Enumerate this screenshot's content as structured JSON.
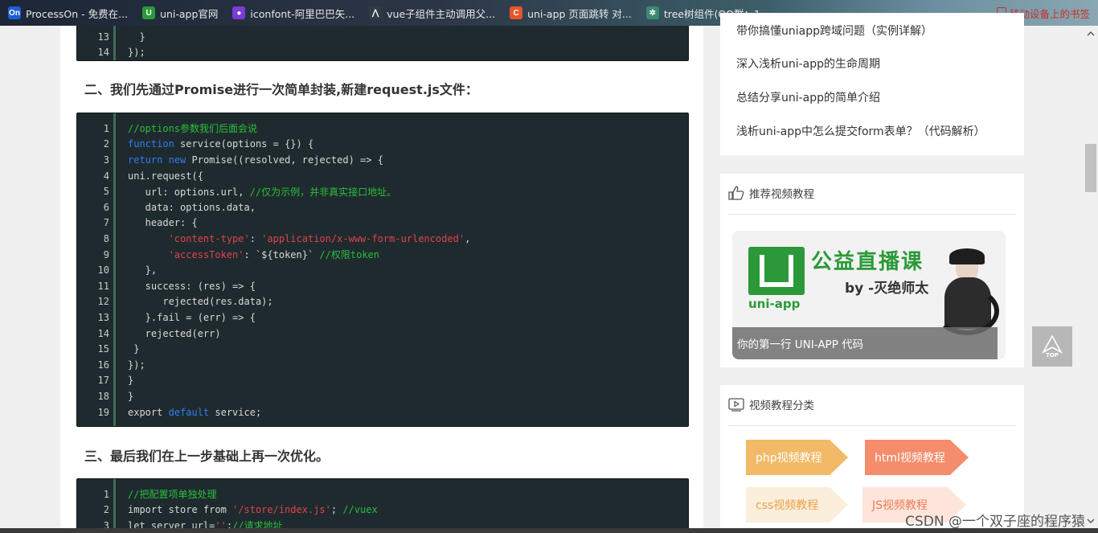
{
  "bookmarks": [
    {
      "label": "ProcessOn - 免费在...",
      "icon": "processon-icon",
      "badge": "On",
      "color": "#1a5fd1"
    },
    {
      "label": "uni-app官网",
      "icon": "uniapp-icon",
      "badge": "U",
      "color": "#2b9939"
    },
    {
      "label": "iconfont-阿里巴巴矢...",
      "icon": "iconfont-icon",
      "badge": "●",
      "color": "#7b3bd8"
    },
    {
      "label": "vue子组件主动调用父...",
      "icon": "vue-icon",
      "badge": "⋀",
      "color": "#2f3a44"
    },
    {
      "label": "uni-app 页面跳转 对...",
      "icon": "csdn-icon",
      "badge": "C",
      "color": "#e8542a"
    },
    {
      "label": "tree树组件(QQ群：1...",
      "icon": "tree-icon",
      "badge": "✲",
      "color": "#3a8a6e"
    }
  ],
  "bookmarks_right": "移动设备上的书签",
  "code_block_1": {
    "lines": [
      {
        "n": "13",
        "tokens": [
          {
            "t": "  }"
          }
        ]
      },
      {
        "n": "14",
        "tokens": [
          {
            "t": "});"
          }
        ]
      }
    ]
  },
  "heading_2": "二、我们先通过Promise进行一次简单封装,新建request.js文件：",
  "code_block_2": {
    "lines": [
      {
        "n": "1",
        "tokens": [
          {
            "t": "//options参数我们后面会说",
            "c": "c-com"
          }
        ]
      },
      {
        "n": "2",
        "tokens": [
          {
            "t": "function",
            "c": "c-kw"
          },
          {
            "t": " service(options = {}) {"
          }
        ]
      },
      {
        "n": "3",
        "tokens": [
          {
            "t": "return",
            "c": "c-kw"
          },
          {
            "t": " "
          },
          {
            "t": "new",
            "c": "c-kw"
          },
          {
            "t": " Promise((resolved, rejected) => {"
          }
        ]
      },
      {
        "n": "4",
        "tokens": [
          {
            "t": "uni.request({"
          }
        ]
      },
      {
        "n": "5",
        "tokens": [
          {
            "t": "   url: options.url, "
          },
          {
            "t": "//仅为示例，并非真实接口地址。",
            "c": "c-com"
          }
        ]
      },
      {
        "n": "6",
        "tokens": [
          {
            "t": "   data: options.data,"
          }
        ]
      },
      {
        "n": "7",
        "tokens": [
          {
            "t": "   header: {"
          }
        ]
      },
      {
        "n": "8",
        "tokens": [
          {
            "t": "       "
          },
          {
            "t": "'content-type'",
            "c": "c-str"
          },
          {
            "t": ": "
          },
          {
            "t": "'application/x-www-form-urlencoded'",
            "c": "c-str"
          },
          {
            "t": ","
          }
        ]
      },
      {
        "n": "9",
        "tokens": [
          {
            "t": "       "
          },
          {
            "t": "'accessToken'",
            "c": "c-str"
          },
          {
            "t": ": `${token}` "
          },
          {
            "t": "//权限token",
            "c": "c-com"
          }
        ]
      },
      {
        "n": "10",
        "tokens": [
          {
            "t": "   },"
          }
        ]
      },
      {
        "n": "11",
        "tokens": [
          {
            "t": "   success: (res) => {"
          }
        ]
      },
      {
        "n": "12",
        "tokens": [
          {
            "t": "      rejected(res.data);"
          }
        ]
      },
      {
        "n": "13",
        "tokens": [
          {
            "t": "   }.fail = (err) => {"
          }
        ]
      },
      {
        "n": "14",
        "tokens": [
          {
            "t": "   rejected(err)"
          }
        ]
      },
      {
        "n": "15",
        "tokens": [
          {
            "t": " }"
          }
        ]
      },
      {
        "n": "16",
        "tokens": [
          {
            "t": "});"
          }
        ]
      },
      {
        "n": "17",
        "tokens": [
          {
            "t": "}"
          }
        ]
      },
      {
        "n": "18",
        "tokens": [
          {
            "t": "}"
          }
        ]
      },
      {
        "n": "19",
        "tokens": [
          {
            "t": "export "
          },
          {
            "t": "default",
            "c": "c-kw"
          },
          {
            "t": " service;"
          }
        ]
      }
    ]
  },
  "heading_3": "三、最后我们在上一步基础上再一次优化。",
  "code_block_3": {
    "lines": [
      {
        "n": "1",
        "tokens": [
          {
            "t": "//把配置项单独处理",
            "c": "c-com"
          }
        ]
      },
      {
        "n": "2",
        "tokens": [
          {
            "t": "import store from "
          },
          {
            "t": "'/store/index.js'",
            "c": "c-str"
          },
          {
            "t": "; "
          },
          {
            "t": "//vuex",
            "c": "c-com"
          }
        ]
      },
      {
        "n": "3",
        "tokens": [
          {
            "t": "let server_url="
          },
          {
            "t": "''",
            "c": "c-str"
          },
          {
            "t": ";"
          },
          {
            "t": "//请求地址",
            "c": "c-com"
          }
        ]
      }
    ]
  },
  "related_articles": [
    "带你搞懂uniapp跨域问题（实例详解）",
    "深入浅析uni-app的生命周期",
    "总结分享uni-app的简单介绍",
    "浅析uni-app中怎么提交form表单？（代码解析）"
  ],
  "video_card": {
    "title": "推荐视频教程",
    "banner_title": "公益直播课",
    "banner_byline": "by -灭绝师太",
    "banner_logo_text": "uni-app",
    "caption": "你的第一行 UNI-APP 代码"
  },
  "category_card": {
    "title": "视频教程分类",
    "tags": [
      {
        "label": "php视频教程",
        "color": "#f2b967"
      },
      {
        "label": "html视频教程",
        "color": "#f58c6c"
      },
      {
        "label": "css视频教程",
        "color": "#fbeedb"
      },
      {
        "label": "JS视频教程",
        "color": "#fde5dc"
      }
    ]
  },
  "top_button": "TOP",
  "watermark": "CSDN @一个双子座的程序猿"
}
